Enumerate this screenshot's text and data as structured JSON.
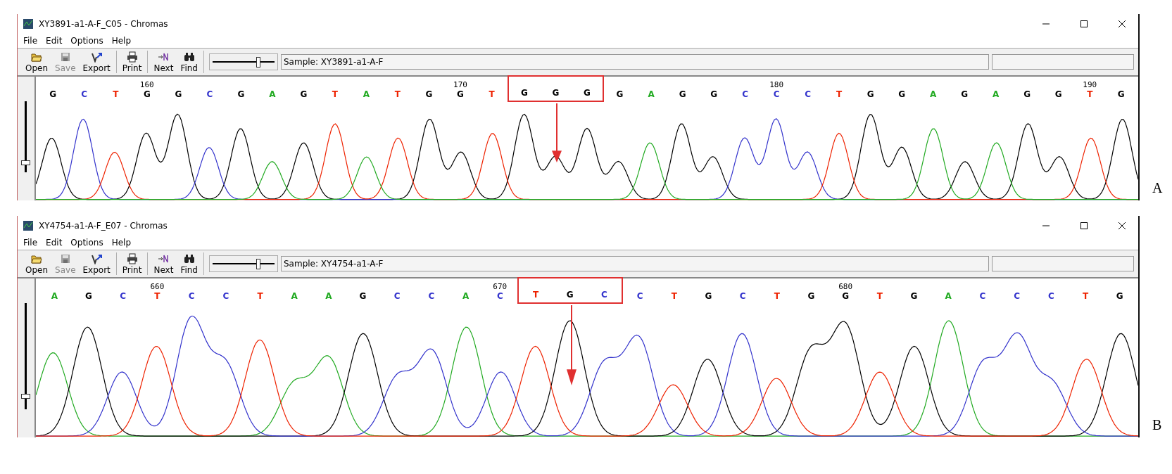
{
  "windows": [
    {
      "title": "XY3891-a1-A-F_C05 - Chromas",
      "menu": [
        "File",
        "Edit",
        "Options",
        "Help"
      ],
      "toolbar_groups": [
        [
          {
            "kind": "open",
            "label": "Open",
            "disabled": false
          },
          {
            "kind": "save",
            "label": "Save",
            "disabled": true
          },
          {
            "kind": "export",
            "label": "Export",
            "disabled": false
          }
        ],
        [
          {
            "kind": "print",
            "label": "Print",
            "disabled": false
          }
        ],
        [
          {
            "kind": "next",
            "label": "Next",
            "disabled": false
          },
          {
            "kind": "find",
            "label": "Find",
            "disabled": false
          }
        ]
      ],
      "zoom_slider": {
        "level": 0.75
      },
      "sample": "Sample: XY3891-a1-A-F",
      "scale_slider": {
        "level": 0.1
      },
      "sequence": [
        {
          "kind": "plain",
          "bases": [
            {
              "base": "G",
              "color": "#000000"
            },
            {
              "base": "C",
              "color": "#3333cc"
            },
            {
              "base": "T",
              "color": "#ee2200"
            },
            {
              "base": "G",
              "color": "#000000",
              "tick": "160"
            },
            {
              "base": "G",
              "color": "#000000"
            },
            {
              "base": "C",
              "color": "#3333cc"
            },
            {
              "base": "G",
              "color": "#000000"
            },
            {
              "base": "A",
              "color": "#22aa22"
            },
            {
              "base": "G",
              "color": "#000000"
            },
            {
              "base": "T",
              "color": "#ee2200"
            },
            {
              "base": "A",
              "color": "#22aa22"
            },
            {
              "base": "T",
              "color": "#ee2200"
            },
            {
              "base": "G",
              "color": "#000000"
            },
            {
              "base": "G",
              "color": "#000000",
              "tick": "170"
            },
            {
              "base": "T",
              "color": "#ee2200"
            }
          ]
        },
        {
          "kind": "boxed",
          "bases": [
            {
              "base": "G",
              "color": "#000000"
            },
            {
              "base": "G",
              "color": "#000000"
            },
            {
              "base": "G",
              "color": "#000000"
            }
          ]
        },
        {
          "kind": "plain",
          "bases": [
            {
              "base": "G",
              "color": "#000000"
            },
            {
              "base": "A",
              "color": "#22aa22"
            },
            {
              "base": "G",
              "color": "#000000"
            },
            {
              "base": "G",
              "color": "#000000"
            },
            {
              "base": "C",
              "color": "#3333cc"
            },
            {
              "base": "C",
              "color": "#3333cc",
              "tick": "180"
            },
            {
              "base": "C",
              "color": "#3333cc"
            },
            {
              "base": "T",
              "color": "#ee2200"
            },
            {
              "base": "G",
              "color": "#000000"
            },
            {
              "base": "G",
              "color": "#000000"
            },
            {
              "base": "A",
              "color": "#22aa22"
            },
            {
              "base": "G",
              "color": "#000000"
            },
            {
              "base": "A",
              "color": "#22aa22"
            },
            {
              "base": "G",
              "color": "#000000"
            },
            {
              "base": "G",
              "color": "#000000"
            },
            {
              "base": "T",
              "color": "#ee2200",
              "tick": "190"
            },
            {
              "base": "G",
              "color": "#000000"
            }
          ]
        }
      ],
      "panel_label": "A"
    },
    {
      "title": "XY4754-a1-A-F_E07 - Chromas",
      "menu": [
        "File",
        "Edit",
        "Options",
        "Help"
      ],
      "toolbar_groups": [
        [
          {
            "kind": "open",
            "label": "Open",
            "disabled": false
          },
          {
            "kind": "save",
            "label": "Save",
            "disabled": true
          },
          {
            "kind": "export",
            "label": "Export",
            "disabled": false
          }
        ],
        [
          {
            "kind": "print",
            "label": "Print",
            "disabled": false
          }
        ],
        [
          {
            "kind": "next",
            "label": "Next",
            "disabled": false
          },
          {
            "kind": "find",
            "label": "Find",
            "disabled": false
          }
        ]
      ],
      "zoom_slider": {
        "level": 0.75
      },
      "sample": "Sample: XY4754-a1-A-F",
      "scale_slider": {
        "level": 0.1
      },
      "sequence": [
        {
          "kind": "plain",
          "bases": [
            {
              "base": "A",
              "color": "#22aa22"
            },
            {
              "base": "G",
              "color": "#000000"
            },
            {
              "base": "C",
              "color": "#3333cc"
            },
            {
              "base": "T",
              "color": "#ee2200",
              "tick": "660"
            },
            {
              "base": "C",
              "color": "#3333cc"
            },
            {
              "base": "C",
              "color": "#3333cc"
            },
            {
              "base": "T",
              "color": "#ee2200"
            },
            {
              "base": "A",
              "color": "#22aa22"
            },
            {
              "base": "A",
              "color": "#22aa22"
            },
            {
              "base": "G",
              "color": "#000000"
            },
            {
              "base": "C",
              "color": "#3333cc"
            },
            {
              "base": "C",
              "color": "#3333cc"
            },
            {
              "base": "A",
              "color": "#22aa22"
            },
            {
              "base": "C",
              "color": "#3333cc",
              "tick": "670"
            }
          ]
        },
        {
          "kind": "boxed",
          "bases": [
            {
              "base": "T",
              "color": "#ee2200"
            },
            {
              "base": "G",
              "color": "#000000"
            },
            {
              "base": "C",
              "color": "#3333cc"
            }
          ]
        },
        {
          "kind": "plain",
          "bases": [
            {
              "base": "C",
              "color": "#3333cc"
            },
            {
              "base": "T",
              "color": "#ee2200"
            },
            {
              "base": "G",
              "color": "#000000"
            },
            {
              "base": "C",
              "color": "#3333cc"
            },
            {
              "base": "T",
              "color": "#ee2200"
            },
            {
              "base": "G",
              "color": "#000000"
            },
            {
              "base": "G",
              "color": "#000000",
              "tick": "680"
            },
            {
              "base": "T",
              "color": "#ee2200"
            },
            {
              "base": "G",
              "color": "#000000"
            },
            {
              "base": "A",
              "color": "#22aa22"
            },
            {
              "base": "C",
              "color": "#3333cc"
            },
            {
              "base": "C",
              "color": "#3333cc"
            },
            {
              "base": "C",
              "color": "#3333cc"
            },
            {
              "base": "T",
              "color": "#ee2200"
            },
            {
              "base": "G",
              "color": "#000000"
            }
          ]
        }
      ],
      "panel_label": "B"
    }
  ]
}
